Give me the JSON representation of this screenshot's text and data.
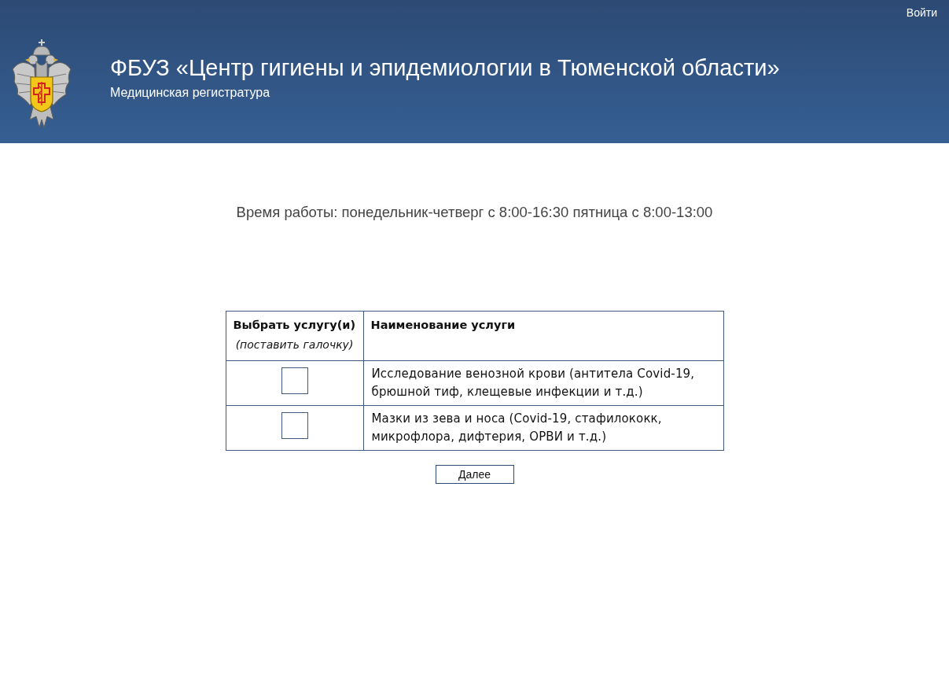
{
  "header": {
    "login_link": "Войти",
    "title": "ФБУЗ «Центр гигиены и эпидемиологии в Тюменской области»",
    "subtitle": "Медицинская регистратура"
  },
  "hours": "Время работы: понедельник-четверг с 8:00-16:30 пятница с 8:00-13:00",
  "table": {
    "columns": [
      {
        "title": "Выбрать услугу(и)",
        "hint": "(поставить галочку)"
      },
      {
        "title": "Наименование услуги"
      }
    ],
    "rows": [
      {
        "checked": false,
        "service": "Исследование венозной крови (антитела Covid-19, брюшной тиф, клещевые инфекции и т.д.)"
      },
      {
        "checked": false,
        "service": "Мазки из зева и носа (Covid-19, стафилококк, микрофлора, дифтерия, ОРВИ и т.д.)"
      }
    ]
  },
  "next_button": "Далее"
}
